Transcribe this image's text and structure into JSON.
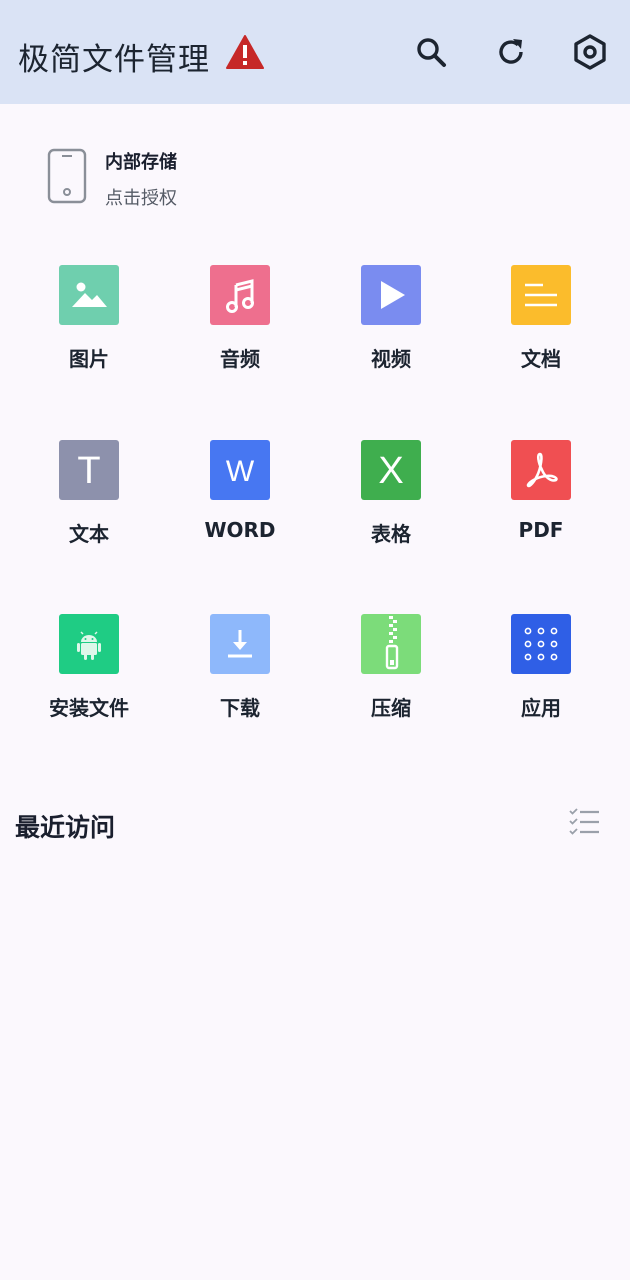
{
  "app": {
    "title": "极简文件管理",
    "icons": {
      "warning": "warning-icon",
      "search": "search-icon",
      "refresh": "refresh-icon",
      "settings": "settings-icon"
    }
  },
  "storage": {
    "title": "内部存储",
    "subtitle": "点击授权",
    "icon": "phone-icon"
  },
  "categories": [
    {
      "label": "图片",
      "icon": "image-icon",
      "color": "#6fcfae"
    },
    {
      "label": "音频",
      "icon": "music-icon",
      "color": "#ee6f8e"
    },
    {
      "label": "视频",
      "icon": "play-icon",
      "color": "#7a8cf0"
    },
    {
      "label": "文档",
      "icon": "document-icon",
      "color": "#fbbc2c"
    },
    {
      "label": "文本",
      "icon": "text-t-icon",
      "color": "#8d91ac"
    },
    {
      "label": "WORD",
      "icon": "word-w-icon",
      "color": "#4777f2"
    },
    {
      "label": "表格",
      "icon": "excel-x-icon",
      "color": "#3fae4e"
    },
    {
      "label": "PDF",
      "icon": "pdf-icon",
      "color": "#f04f52"
    },
    {
      "label": "安装文件",
      "icon": "android-icon",
      "color": "#1fcc84"
    },
    {
      "label": "下载",
      "icon": "download-icon",
      "color": "#8eb8fb"
    },
    {
      "label": "压缩",
      "icon": "zip-icon",
      "color": "#7cdc7a"
    },
    {
      "label": "应用",
      "icon": "apps-grid-icon",
      "color": "#2f5fe6"
    }
  ],
  "tile_glyphs": {
    "text": "T",
    "word": "W",
    "excel": "X"
  },
  "recent": {
    "title": "最近访问",
    "icon": "checklist-icon"
  }
}
